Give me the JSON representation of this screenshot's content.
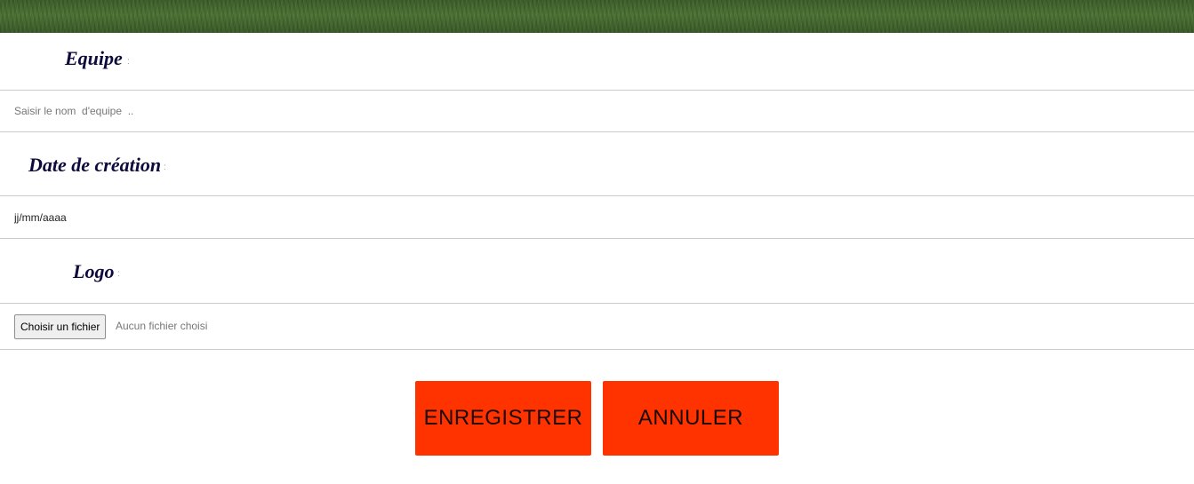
{
  "form": {
    "equipe": {
      "label": "Equipe",
      "colon": ":",
      "placeholder": "Saisir le nom  d'equipe  .."
    },
    "date_creation": {
      "label": "Date de création",
      "colon": ":",
      "value": "jj/mm/aaaa"
    },
    "logo": {
      "label": "Logo",
      "colon": ":",
      "file_button": "Choisir un fichier",
      "file_status": "Aucun fichier choisi"
    }
  },
  "actions": {
    "save": "ENREGISTRER",
    "cancel": "ANNULER"
  },
  "colors": {
    "button_bg": "#ff3300",
    "label_color": "#0d0a3c"
  }
}
